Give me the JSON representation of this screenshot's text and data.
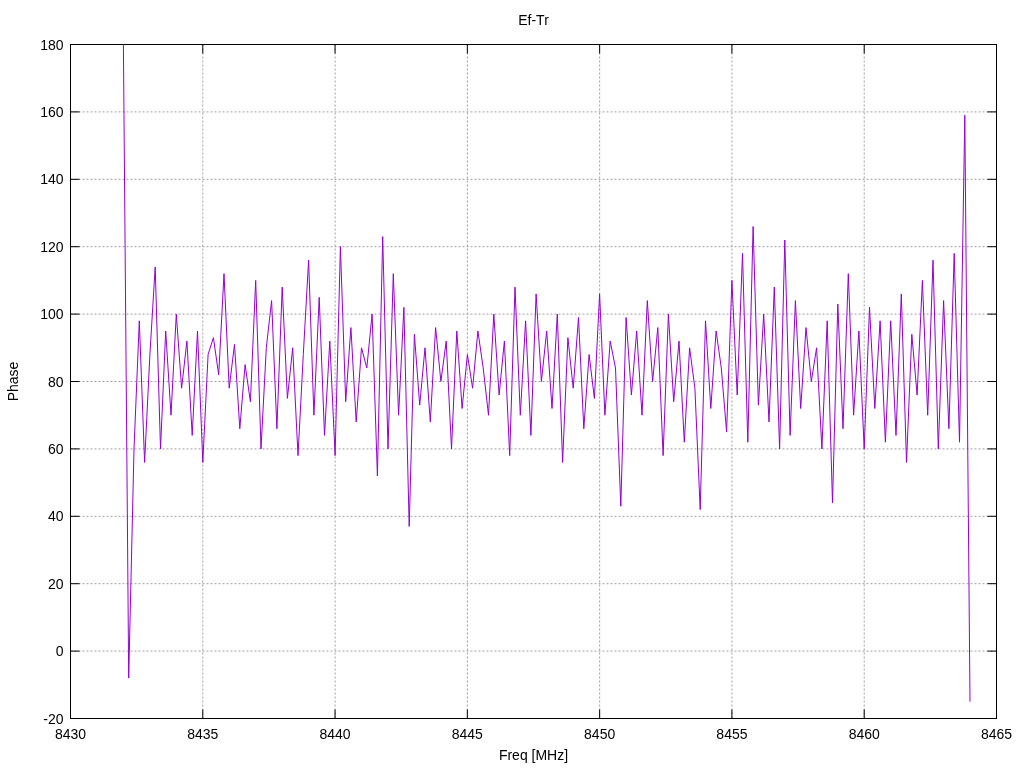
{
  "chart_data": {
    "type": "line",
    "title": "Ef-Tr",
    "grid": true,
    "xlabel": "Freq [MHz]",
    "ylabel": "Phase",
    "xlim": [
      8430,
      8465
    ],
    "ylim": [
      -20,
      180
    ],
    "xticks": [
      8430,
      8435,
      8440,
      8445,
      8450,
      8455,
      8460,
      8465
    ],
    "yticks": [
      -20,
      0,
      20,
      40,
      60,
      80,
      100,
      120,
      140,
      160,
      180
    ],
    "x": [
      8432,
      8432.2,
      8432.4,
      8432.6,
      8432.8,
      8433,
      8433.2,
      8433.4,
      8433.6,
      8433.8,
      8434,
      8434.2,
      8434.4,
      8434.6,
      8434.8,
      8435,
      8435.2,
      8435.4,
      8435.6,
      8435.8,
      8436,
      8436.2,
      8436.4,
      8436.6,
      8436.8,
      8437,
      8437.2,
      8437.4,
      8437.6,
      8437.8,
      8438,
      8438.2,
      8438.4,
      8438.6,
      8438.8,
      8439,
      8439.2,
      8439.4,
      8439.6,
      8439.8,
      8440,
      8440.2,
      8440.4,
      8440.6,
      8440.8,
      8441,
      8441.2,
      8441.4,
      8441.6,
      8441.8,
      8442,
      8442.2,
      8442.4,
      8442.6,
      8442.8,
      8443,
      8443.2,
      8443.4,
      8443.6,
      8443.8,
      8444,
      8444.2,
      8444.4,
      8444.6,
      8444.8,
      8445,
      8445.2,
      8445.4,
      8445.6,
      8445.8,
      8446,
      8446.2,
      8446.4,
      8446.6,
      8446.8,
      8447,
      8447.2,
      8447.4,
      8447.6,
      8447.8,
      8448,
      8448.2,
      8448.4,
      8448.6,
      8448.8,
      8449,
      8449.2,
      8449.4,
      8449.6,
      8449.8,
      8450,
      8450.2,
      8450.4,
      8450.6,
      8450.8,
      8451,
      8451.2,
      8451.4,
      8451.6,
      8451.8,
      8452,
      8452.2,
      8452.4,
      8452.6,
      8452.8,
      8453,
      8453.2,
      8453.4,
      8453.6,
      8453.8,
      8454,
      8454.2,
      8454.4,
      8454.6,
      8454.8,
      8455,
      8455.2,
      8455.4,
      8455.6,
      8455.8,
      8456,
      8456.2,
      8456.4,
      8456.6,
      8456.8,
      8457,
      8457.2,
      8457.4,
      8457.6,
      8457.8,
      8458,
      8458.2,
      8458.4,
      8458.6,
      8458.8,
      8459,
      8459.2,
      8459.4,
      8459.6,
      8459.8,
      8460,
      8460.2,
      8460.4,
      8460.6,
      8460.8,
      8461,
      8461.2,
      8461.4,
      8461.6,
      8461.8,
      8462,
      8462.2,
      8462.4,
      8462.6,
      8462.8,
      8463,
      8463.2,
      8463.4,
      8463.6,
      8463.8,
      8464
    ],
    "series": [
      {
        "color": "#9400d3",
        "values": [
          180,
          -8,
          60,
          98,
          56,
          88,
          114,
          60,
          95,
          70,
          100,
          78,
          92,
          64,
          95,
          56,
          88,
          93,
          82,
          112,
          78,
          91,
          66,
          85,
          74,
          110,
          60,
          90,
          104,
          66,
          108,
          75,
          90,
          58,
          88,
          116,
          70,
          105,
          64,
          92,
          58,
          120,
          74,
          96,
          68,
          90,
          84,
          100,
          52,
          123,
          60,
          112,
          70,
          102,
          37,
          94,
          73,
          90,
          68,
          96,
          80,
          92,
          60,
          95,
          72,
          88,
          78,
          95,
          84,
          70,
          100,
          76,
          92,
          58,
          108,
          70,
          98,
          64,
          106,
          80,
          95,
          72,
          100,
          56,
          93,
          78,
          99,
          66,
          88,
          75,
          106,
          70,
          92,
          84,
          43,
          99,
          76,
          95,
          70,
          104,
          80,
          96,
          58,
          100,
          74,
          92,
          62,
          90,
          78,
          42,
          98,
          72,
          95,
          84,
          65,
          110,
          76,
          118,
          62,
          126,
          73,
          100,
          68,
          108,
          60,
          122,
          64,
          104,
          72,
          96,
          80,
          90,
          60,
          98,
          44,
          103,
          66,
          112,
          70,
          95,
          60,
          102,
          72,
          98,
          62,
          98,
          64,
          106,
          56,
          94,
          76,
          110,
          70,
          116,
          60,
          104,
          66,
          118,
          62,
          159,
          -15
        ]
      }
    ]
  }
}
